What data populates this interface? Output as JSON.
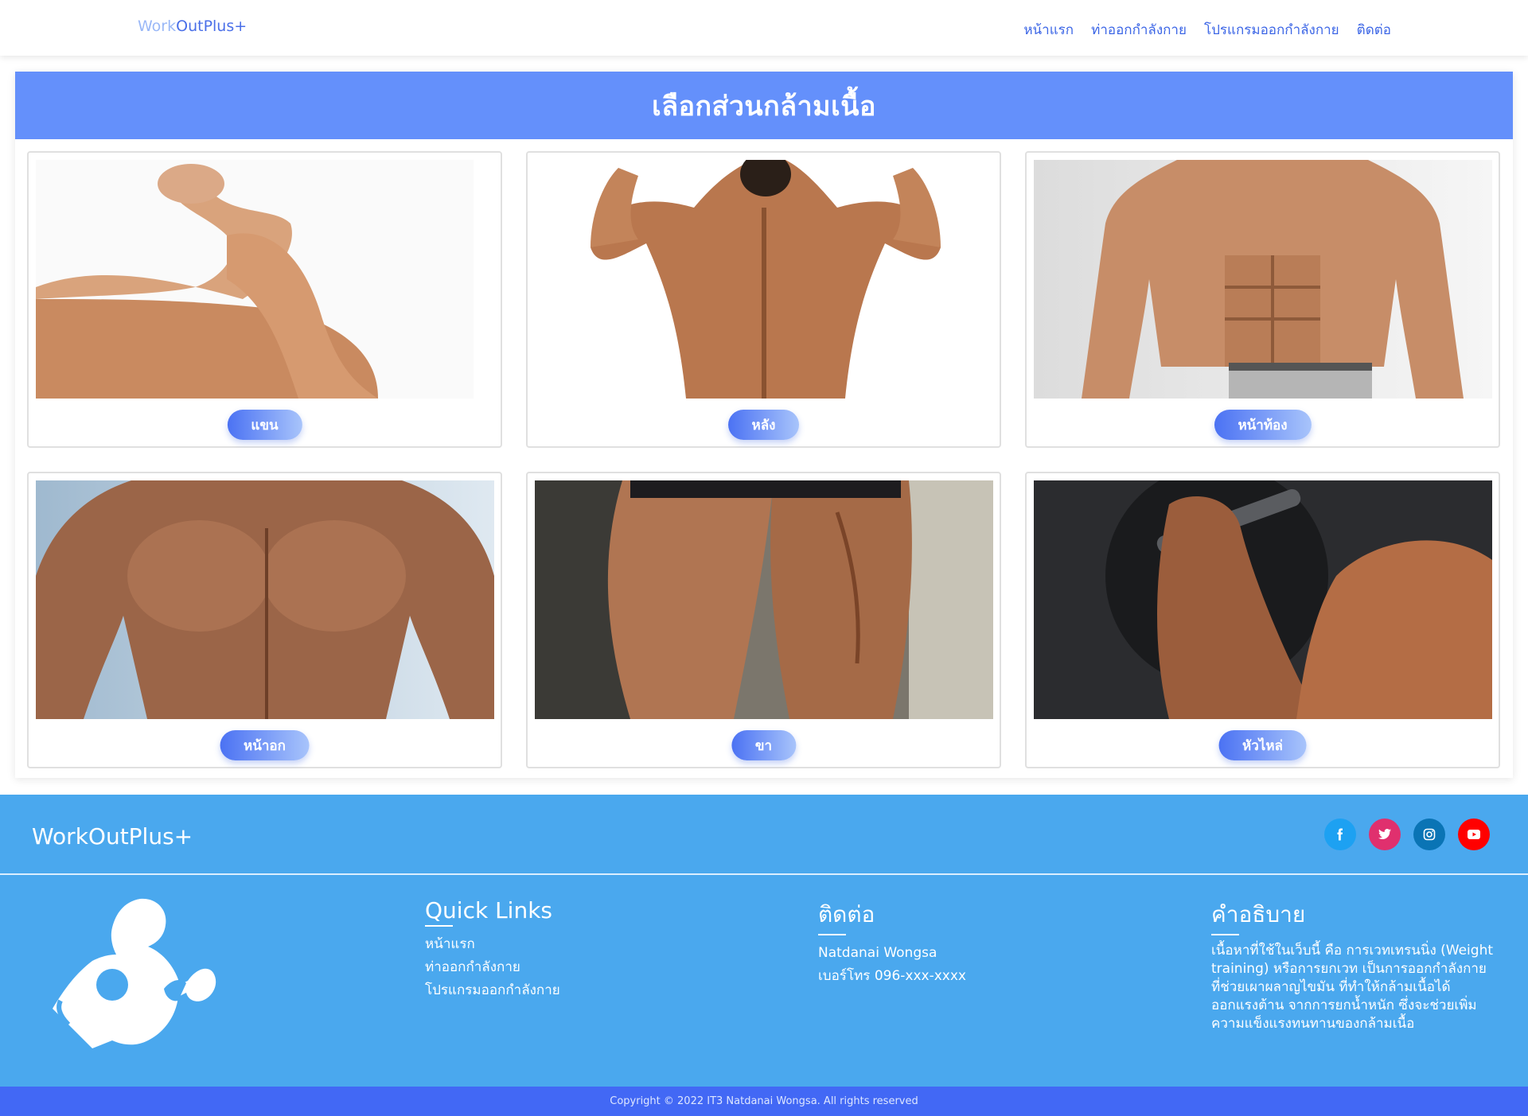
{
  "nav": {
    "brand_part1": "Work",
    "brand_part2": "OutPlus+",
    "links": [
      "หน้าแรก",
      "ท่าออกกำลังกาย",
      "โปรแกรมออกกำลังกาย",
      "ติดต่อ"
    ]
  },
  "section": {
    "title": "เลือกส่วนกล้ามเนื้อ",
    "cards": [
      {
        "label": "แขน",
        "image": "arm-muscle-photo"
      },
      {
        "label": "หลัง",
        "image": "back-muscle-photo"
      },
      {
        "label": "หน้าท้อง",
        "image": "abs-muscle-photo"
      },
      {
        "label": "หน้าอก",
        "image": "chest-muscle-photo"
      },
      {
        "label": "ขา",
        "image": "leg-muscle-photo"
      },
      {
        "label": "หัวไหล่",
        "image": "shoulder-muscle-photo"
      }
    ]
  },
  "footer": {
    "brand": "WorkOutPlus+",
    "social": [
      {
        "icon": "facebook-icon",
        "color": "#1da1f2"
      },
      {
        "icon": "twitter-icon",
        "color": "#e0306e"
      },
      {
        "icon": "instagram-icon",
        "color": "#0a74b5"
      },
      {
        "icon": "youtube-icon",
        "color": "#ff0000"
      }
    ],
    "quick_links": {
      "title": "Quick Links",
      "items": [
        "หน้าแรก",
        "ท่าออกกำลังกาย",
        "โปรแกรมออกกำลังกาย"
      ]
    },
    "contact": {
      "title": "ติดต่อ",
      "name": "Natdanai Wongsa",
      "phone": "เบอร์โทร 096-xxx-xxxx"
    },
    "description": {
      "title": "คำอธิบาย",
      "text": "เนื้อหาที่ใช้ในเว็บนี้ คือ การเวทเทรนนิ่ง (Weight training) หรือการยกเวท เป็นการออกกำลังกายที่ช่วยเผาผลาญไขมัน ที่ทำให้กล้ามเนื้อได้ออกแรงต้าน จากการยกน้ำหนัก ซึ่งจะช่วยเพิ่มความแข็งแรงทนทานของกล้ามเนื้อ"
    },
    "copyright": "Copyright © 2022 IT3 Natdanai Wongsa. All rights reserved"
  }
}
